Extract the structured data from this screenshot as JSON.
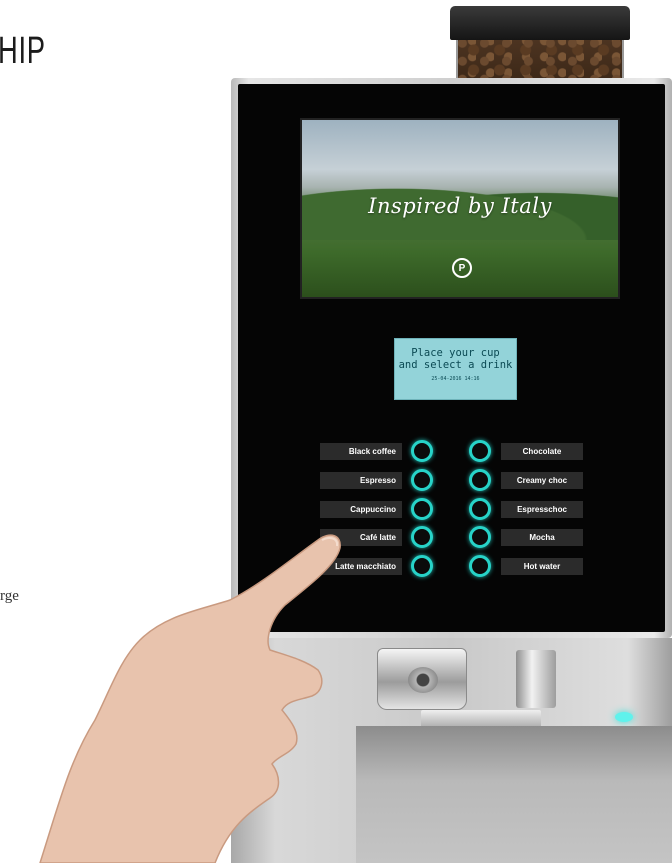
{
  "page": {
    "cut_title": "HIP",
    "cut_side_text": "rge"
  },
  "display": {
    "tagline": "Inspired by Italy",
    "logo_glyph": "P"
  },
  "lcd": {
    "line1": "Place your cup",
    "line2": "and select a drink",
    "datetime": "25-04-2016 14:16"
  },
  "drinks_left": [
    "Black coffee",
    "Espresso",
    "Cappuccino",
    "Café latte",
    "Latte macchiato"
  ],
  "drinks_right": [
    "Chocolate",
    "Creamy choc",
    "Espresschoc",
    "Mocha",
    "Hot water"
  ],
  "colors": {
    "ring_accent": "#27d3c8",
    "lcd_background": "#93d3d9",
    "panel_black": "#050505"
  }
}
